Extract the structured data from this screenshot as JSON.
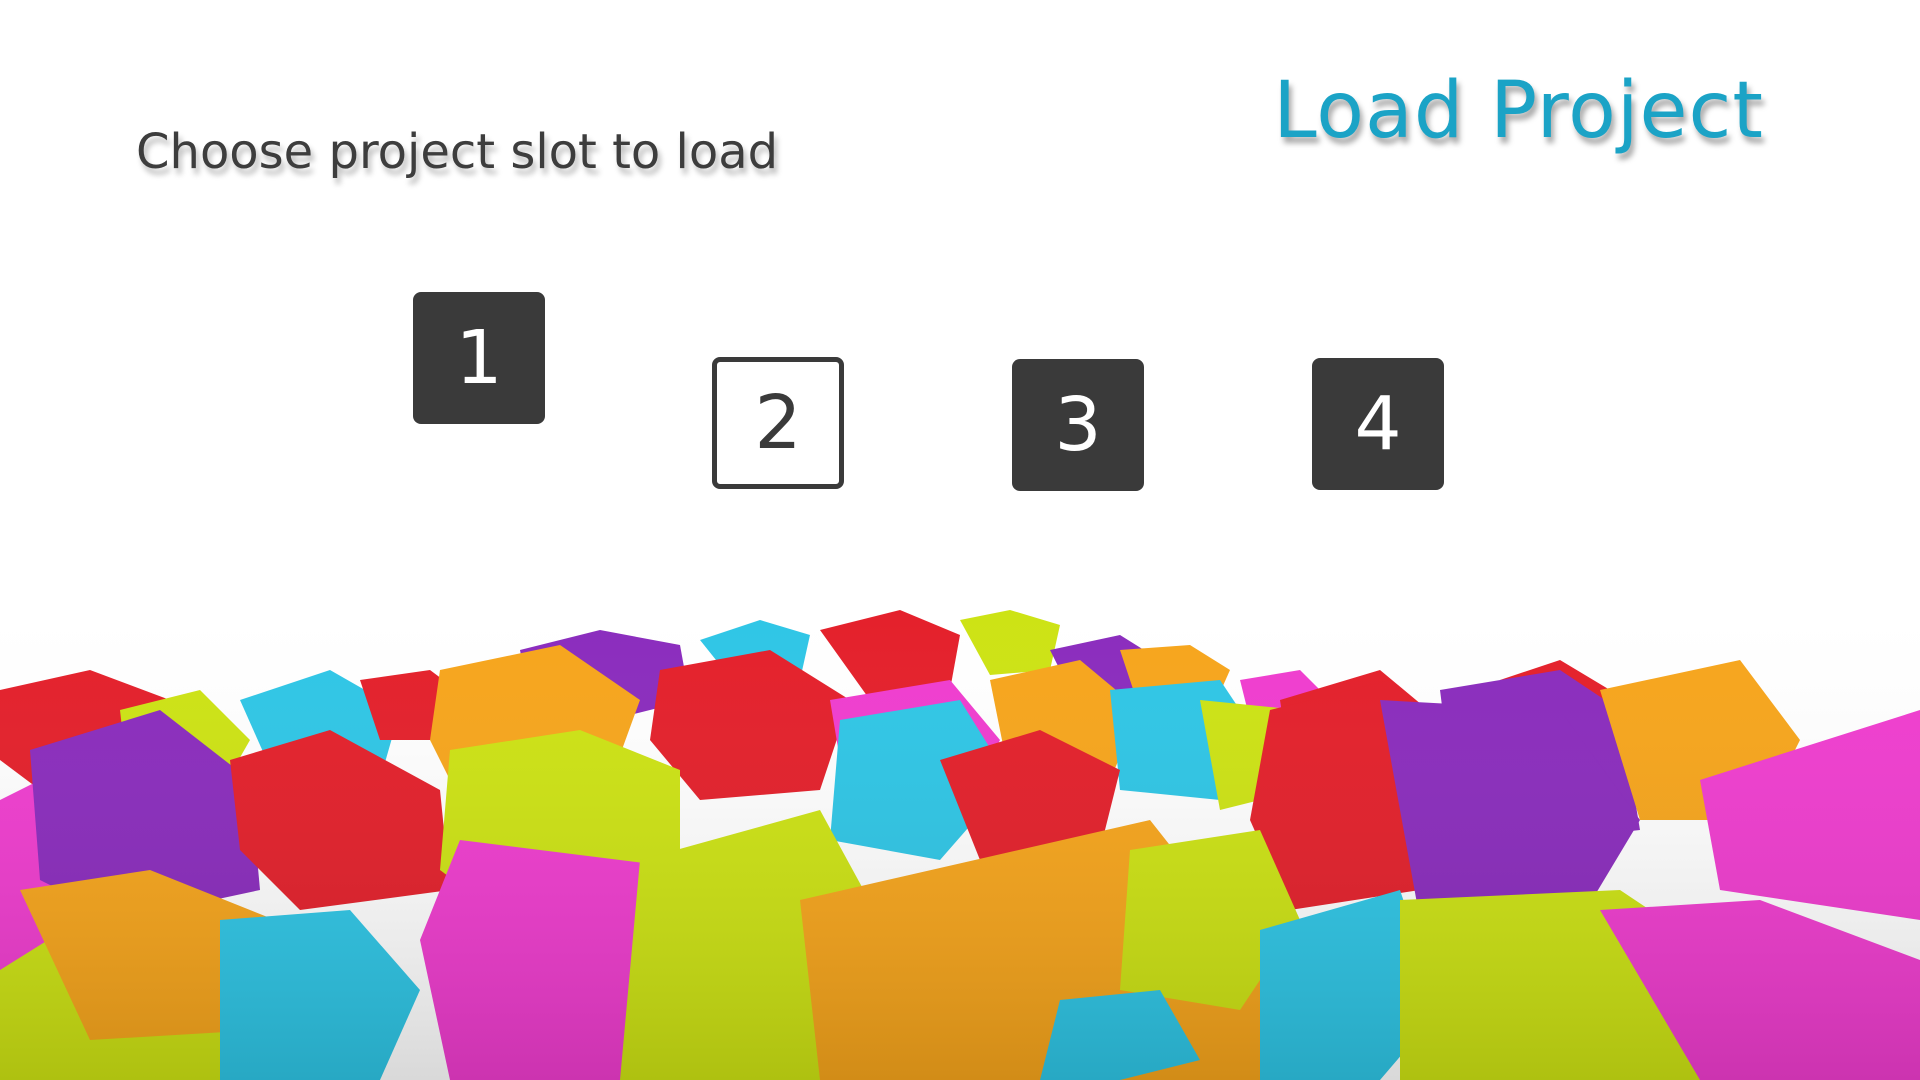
{
  "header": {
    "title": "Load Project",
    "title_color": "#1ba3c6"
  },
  "prompt": {
    "text": "Choose project slot to load"
  },
  "slots": [
    {
      "label": "1",
      "state": "filled"
    },
    {
      "label": "2",
      "state": "selected"
    },
    {
      "label": "3",
      "state": "filled"
    },
    {
      "label": "4",
      "state": "filled"
    }
  ],
  "theme": {
    "slot_color": "#3a3a3a",
    "cube_colors": [
      "#e41f2a",
      "#8a2bbd",
      "#f7a51b",
      "#cde313",
      "#2ec6e6",
      "#f03ccf"
    ]
  },
  "decoration": {
    "background_image": "colorful-cubes"
  }
}
